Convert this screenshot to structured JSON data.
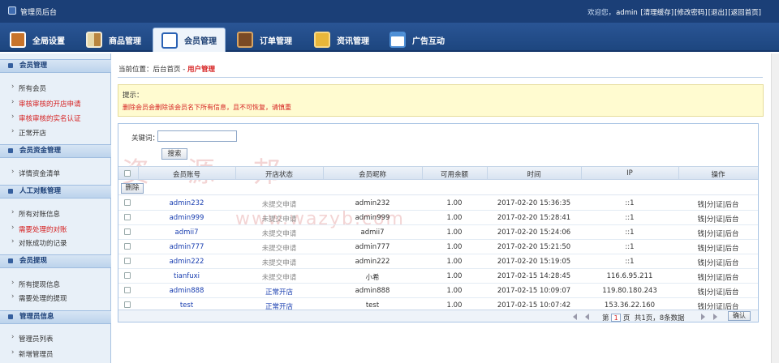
{
  "header": {
    "title": "管理员后台",
    "welcome": "欢迎您，",
    "user": "admin",
    "links": [
      "[清理缓存]",
      "[修改密码]",
      "[退出]",
      "[返回首页]"
    ]
  },
  "nav": {
    "tabs": [
      {
        "label": "全局设置",
        "icon": "furniture-icon"
      },
      {
        "label": "商品管理",
        "icon": "grid-icon"
      },
      {
        "label": "会员管理",
        "icon": "users-icon",
        "active": true
      },
      {
        "label": "订单管理",
        "icon": "wallet-icon"
      },
      {
        "label": "资讯管理",
        "icon": "folder-icon"
      },
      {
        "label": "广告互动",
        "icon": "window-icon"
      }
    ]
  },
  "sidebar": {
    "groups": [
      {
        "title": "会员管理",
        "items": [
          {
            "label": "所有会员",
            "red": false
          },
          {
            "label": "审核审核的开店申请",
            "red": true
          },
          {
            "label": "审核审核的实名认证",
            "red": true
          },
          {
            "label": "正常开店",
            "red": false
          }
        ]
      },
      {
        "title": "会员资金管理",
        "items": [
          {
            "label": "详情资金清单",
            "red": false
          }
        ]
      },
      {
        "title": "人工对账管理",
        "items": [
          {
            "label": "所有对账信息",
            "red": false
          },
          {
            "label": "需要处理的对账",
            "red": true
          },
          {
            "label": "对账成功的记录",
            "red": false
          }
        ]
      },
      {
        "title": "会员提现",
        "items": [
          {
            "label": "所有提现信息",
            "red": false
          },
          {
            "label": "需要处理的提现",
            "red": false
          }
        ]
      },
      {
        "title": "管理员信息",
        "items": [
          {
            "label": "管理员列表",
            "red": false
          },
          {
            "label": "新增管理员",
            "red": false
          }
        ]
      }
    ]
  },
  "breadcrumb": {
    "prefix": "当前位置：",
    "home": "后台首页",
    "sep": " - ",
    "current": "用户管理"
  },
  "tip": {
    "title": "提示：",
    "text": "删除会员会删除该会员名下所有信息，且不可恢复，请慎重"
  },
  "search": {
    "label": "关键词：",
    "value": "",
    "button": "搜索"
  },
  "table": {
    "columns": [
      "会员账号",
      "开店状态",
      "会员昵称",
      "可用余额",
      "时间",
      "IP",
      "操作"
    ],
    "delete_label": "删除",
    "rows": [
      {
        "account": "admin232",
        "status": "未提交申请",
        "open": false,
        "nick": "admin232",
        "balance": "1.00",
        "time": "2017-02-20 15:36:35",
        "ip": "::1",
        "ops": "钱|分|证|后台"
      },
      {
        "account": "admin999",
        "status": "未提交申请",
        "open": false,
        "nick": "admin999",
        "balance": "1.00",
        "time": "2017-02-20 15:28:41",
        "ip": "::1",
        "ops": "钱|分|证|后台"
      },
      {
        "account": "admii7",
        "status": "未提交申请",
        "open": false,
        "nick": "admii7",
        "balance": "1.00",
        "time": "2017-02-20 15:24:06",
        "ip": "::1",
        "ops": "钱|分|证|后台"
      },
      {
        "account": "admin777",
        "status": "未提交申请",
        "open": false,
        "nick": "admin777",
        "balance": "1.00",
        "time": "2017-02-20 15:21:50",
        "ip": "::1",
        "ops": "钱|分|证|后台"
      },
      {
        "account": "admin222",
        "status": "未提交申请",
        "open": false,
        "nick": "admin222",
        "balance": "1.00",
        "time": "2017-02-20 15:19:05",
        "ip": "::1",
        "ops": "钱|分|证|后台"
      },
      {
        "account": "tianfuxi",
        "status": "未提交申请",
        "open": false,
        "nick": "小希",
        "balance": "1.00",
        "time": "2017-02-15 14:28:45",
        "ip": "116.6.95.211",
        "ops": "钱|分|证|后台"
      },
      {
        "account": "admin888",
        "status": "正常开店",
        "open": true,
        "nick": "admin888",
        "balance": "1.00",
        "time": "2017-02-15 10:09:07",
        "ip": "119.80.180.243",
        "ops": "钱|分|证|后台"
      },
      {
        "account": "test",
        "status": "正常开店",
        "open": true,
        "nick": "test",
        "balance": "1.00",
        "time": "2017-02-15 10:07:42",
        "ip": "153.36.22.160",
        "ops": "钱|分|证|后台"
      }
    ]
  },
  "pager": {
    "prefix": "第",
    "page": "1",
    "suffix": "页",
    "summary": "共1页，8条数据",
    "confirm": "确认"
  },
  "watermark": {
    "text": "资 源 邦",
    "url": "www.wazyb.com"
  }
}
